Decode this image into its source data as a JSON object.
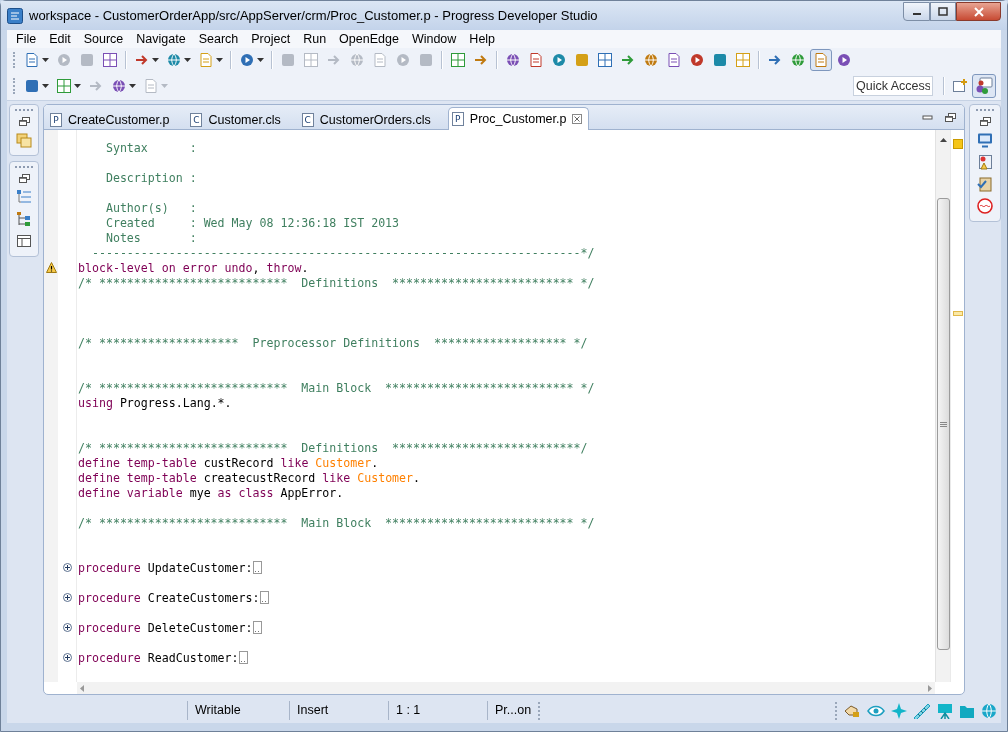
{
  "window": {
    "title": "workspace - CustomerOrderApp/src/AppServer/crm/Proc_Customer.p - Progress Developer Studio"
  },
  "menu": [
    "File",
    "Edit",
    "Source",
    "Navigate",
    "Search",
    "Project",
    "Run",
    "OpenEdge",
    "Window",
    "Help"
  ],
  "toolbar_rows": [
    [
      {
        "kind": "dropdown",
        "disabled": false,
        "pressed": false
      },
      {
        "kind": "button",
        "disabled": true,
        "pressed": false
      },
      {
        "kind": "button",
        "disabled": true,
        "pressed": false
      },
      {
        "kind": "button",
        "disabled": false,
        "pressed": false
      },
      {
        "kind": "separator"
      },
      {
        "kind": "dropdown",
        "disabled": false,
        "pressed": false
      },
      {
        "kind": "dropdown",
        "disabled": false,
        "pressed": false
      },
      {
        "kind": "dropdown",
        "disabled": false,
        "pressed": false
      },
      {
        "kind": "separator"
      },
      {
        "kind": "dropdown",
        "disabled": false,
        "pressed": false
      },
      {
        "kind": "separator"
      },
      {
        "kind": "button",
        "disabled": true,
        "pressed": false
      },
      {
        "kind": "button",
        "disabled": true,
        "pressed": false
      },
      {
        "kind": "button",
        "disabled": true,
        "pressed": false
      },
      {
        "kind": "button",
        "disabled": true,
        "pressed": false
      },
      {
        "kind": "button",
        "disabled": true,
        "pressed": false
      },
      {
        "kind": "button",
        "disabled": true,
        "pressed": false
      },
      {
        "kind": "button",
        "disabled": true,
        "pressed": false
      },
      {
        "kind": "separator"
      },
      {
        "kind": "button",
        "disabled": false,
        "pressed": false
      },
      {
        "kind": "button",
        "disabled": false,
        "pressed": false
      },
      {
        "kind": "separator"
      },
      {
        "kind": "button",
        "disabled": false,
        "pressed": false
      },
      {
        "kind": "button",
        "disabled": false,
        "pressed": false
      },
      {
        "kind": "button",
        "disabled": false,
        "pressed": false
      },
      {
        "kind": "button",
        "disabled": false,
        "pressed": false
      },
      {
        "kind": "button",
        "disabled": false,
        "pressed": false
      },
      {
        "kind": "button",
        "disabled": false,
        "pressed": false
      },
      {
        "kind": "button",
        "disabled": false,
        "pressed": false
      },
      {
        "kind": "button",
        "disabled": false,
        "pressed": false
      },
      {
        "kind": "button",
        "disabled": false,
        "pressed": false
      },
      {
        "kind": "button",
        "disabled": false,
        "pressed": false
      },
      {
        "kind": "button",
        "disabled": false,
        "pressed": false
      },
      {
        "kind": "separator"
      },
      {
        "kind": "button",
        "disabled": false,
        "pressed": false
      },
      {
        "kind": "button",
        "disabled": false,
        "pressed": false
      },
      {
        "kind": "button",
        "disabled": false,
        "pressed": true
      },
      {
        "kind": "button",
        "disabled": false,
        "pressed": false
      }
    ],
    [
      {
        "kind": "dropdown",
        "disabled": false,
        "pressed": false
      },
      {
        "kind": "dropdown",
        "disabled": false,
        "pressed": false
      },
      {
        "kind": "button",
        "disabled": true,
        "pressed": false
      },
      {
        "kind": "dropdown",
        "disabled": false,
        "pressed": false
      },
      {
        "kind": "dropdown",
        "disabled": true,
        "pressed": false
      }
    ]
  ],
  "quick_access": {
    "placeholder": "Quick Access"
  },
  "perspectives": [
    {
      "selected": false
    },
    {
      "selected": true
    }
  ],
  "tabs": [
    {
      "badge": "P",
      "label": "CreateCustomer.p",
      "selected": false
    },
    {
      "badge": "C",
      "label": "Customer.cls",
      "selected": false
    },
    {
      "badge": "C",
      "label": "CustomerOrders.cls",
      "selected": false
    },
    {
      "badge": "P",
      "label": "Proc_Customer.p",
      "selected": true
    }
  ],
  "code_lines": [
    {
      "kind": "text",
      "tokens": [
        {
          "kind": "comment",
          "text": "    Syntax      :"
        }
      ]
    },
    {
      "kind": "blank"
    },
    {
      "kind": "text",
      "tokens": [
        {
          "kind": "comment",
          "text": "    Description :"
        }
      ]
    },
    {
      "kind": "blank"
    },
    {
      "kind": "text",
      "tokens": [
        {
          "kind": "comment",
          "text": "    Author(s)   :"
        }
      ]
    },
    {
      "kind": "text",
      "tokens": [
        {
          "kind": "comment",
          "text": "    Created     : Wed May 08 12:36:18 IST 2013"
        }
      ]
    },
    {
      "kind": "text",
      "tokens": [
        {
          "kind": "comment",
          "text": "    Notes       :"
        }
      ]
    },
    {
      "kind": "text",
      "tokens": [
        {
          "kind": "comment",
          "text": "  ----------------------------------------------------------------------*/"
        }
      ]
    },
    {
      "kind": "warning",
      "tokens": [
        {
          "kind": "keyword",
          "text": "block-level on error undo"
        },
        {
          "kind": "plain",
          "text": ", "
        },
        {
          "kind": "keyword",
          "text": "throw"
        },
        {
          "kind": "plain",
          "text": "."
        }
      ]
    },
    {
      "kind": "text",
      "tokens": [
        {
          "kind": "comment",
          "text": "/* ***************************  Definitions  ************************** */"
        }
      ]
    },
    {
      "kind": "blank"
    },
    {
      "kind": "blank"
    },
    {
      "kind": "blank"
    },
    {
      "kind": "text",
      "tokens": [
        {
          "kind": "comment",
          "text": "/* ********************  Preprocessor Definitions  ******************* */"
        }
      ]
    },
    {
      "kind": "blank"
    },
    {
      "kind": "blank"
    },
    {
      "kind": "text",
      "tokens": [
        {
          "kind": "comment",
          "text": "/* ***************************  Main Block  *************************** */"
        }
      ]
    },
    {
      "kind": "text",
      "tokens": [
        {
          "kind": "keyword",
          "text": "using"
        },
        {
          "kind": "plain",
          "text": " Progress.Lang.*."
        }
      ]
    },
    {
      "kind": "blank"
    },
    {
      "kind": "blank"
    },
    {
      "kind": "text",
      "tokens": [
        {
          "kind": "comment",
          "text": "/* ***************************  Definitions  ***************************/"
        }
      ]
    },
    {
      "kind": "text",
      "tokens": [
        {
          "kind": "keyword",
          "text": "define temp-table"
        },
        {
          "kind": "plain",
          "text": " custRecord "
        },
        {
          "kind": "keyword",
          "text": "like"
        },
        {
          "kind": "type",
          "text": " Customer"
        },
        {
          "kind": "plain",
          "text": "."
        }
      ]
    },
    {
      "kind": "text",
      "tokens": [
        {
          "kind": "keyword",
          "text": "define temp-table"
        },
        {
          "kind": "plain",
          "text": " createcustRecord "
        },
        {
          "kind": "keyword",
          "text": "like"
        },
        {
          "kind": "type",
          "text": " Customer"
        },
        {
          "kind": "plain",
          "text": "."
        }
      ]
    },
    {
      "kind": "text",
      "tokens": [
        {
          "kind": "keyword",
          "text": "define variable"
        },
        {
          "kind": "plain",
          "text": " mye "
        },
        {
          "kind": "keyword",
          "text": "as class"
        },
        {
          "kind": "plain",
          "text": " AppError."
        }
      ]
    },
    {
      "kind": "blank"
    },
    {
      "kind": "text",
      "tokens": [
        {
          "kind": "comment",
          "text": "/* ***************************  Main Block  *************************** */"
        }
      ]
    },
    {
      "kind": "blank"
    },
    {
      "kind": "blank"
    },
    {
      "kind": "folded",
      "tokens": [
        {
          "kind": "keyword",
          "text": "procedure"
        },
        {
          "kind": "plain",
          "text": " UpdateCustomer:"
        }
      ]
    },
    {
      "kind": "blank"
    },
    {
      "kind": "folded",
      "tokens": [
        {
          "kind": "keyword",
          "text": "procedure"
        },
        {
          "kind": "plain",
          "text": " CreateCustomers:"
        }
      ]
    },
    {
      "kind": "blank"
    },
    {
      "kind": "folded",
      "tokens": [
        {
          "kind": "keyword",
          "text": "procedure"
        },
        {
          "kind": "plain",
          "text": " DeleteCustomer:"
        }
      ]
    },
    {
      "kind": "blank"
    },
    {
      "kind": "folded",
      "tokens": [
        {
          "kind": "keyword",
          "text": "procedure"
        },
        {
          "kind": "plain",
          "text": " ReadCustomer:"
        }
      ]
    }
  ],
  "status_bar": {
    "fields": [
      "Writable",
      "Insert",
      "1 : 1",
      "Pr...on"
    ]
  }
}
